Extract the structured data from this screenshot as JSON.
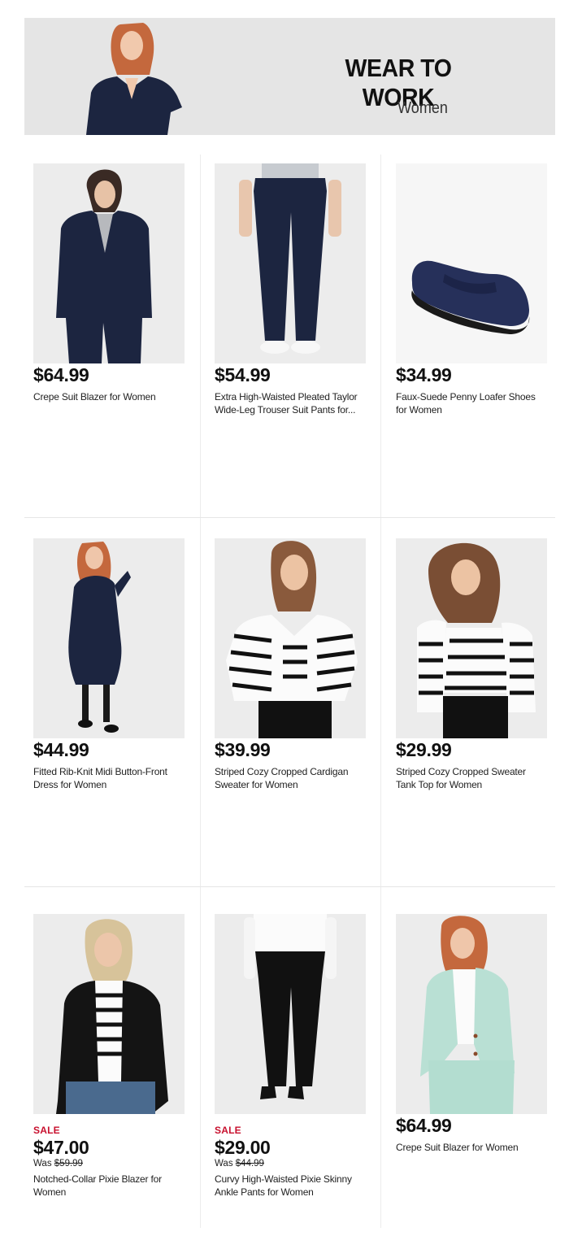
{
  "banner": {
    "title": "WEAR TO WORK",
    "subtitle": "Women"
  },
  "products": [
    {
      "price": "$64.99",
      "name": "Crepe Suit Blazer for Women",
      "sale_label": "",
      "was_prefix": "",
      "was_price": ""
    },
    {
      "price": "$54.99",
      "name": "Extra High-Waisted Pleated Taylor Wide-Leg Trouser Suit Pants for...",
      "sale_label": "",
      "was_prefix": "",
      "was_price": ""
    },
    {
      "price": "$34.99",
      "name": "Faux-Suede Penny Loafer Shoes for Women",
      "sale_label": "",
      "was_prefix": "",
      "was_price": ""
    },
    {
      "price": "$44.99",
      "name": "Fitted Rib-Knit Midi Button-Front Dress for Women",
      "sale_label": "",
      "was_prefix": "",
      "was_price": ""
    },
    {
      "price": "$39.99",
      "name": "Striped Cozy Cropped Cardigan Sweater for Women",
      "sale_label": "",
      "was_prefix": "",
      "was_price": ""
    },
    {
      "price": "$29.99",
      "name": "Striped Cozy Cropped Sweater Tank Top for Women",
      "sale_label": "",
      "was_prefix": "",
      "was_price": ""
    },
    {
      "price": "$47.00",
      "name": "Notched-Collar Pixie Blazer for Women",
      "sale_label": "SALE",
      "was_prefix": "Was ",
      "was_price": "$59.99"
    },
    {
      "price": "$29.00",
      "name": "Curvy High-Waisted Pixie Skinny Ankle Pants for Women",
      "sale_label": "SALE",
      "was_prefix": "Was ",
      "was_price": "$44.99"
    },
    {
      "price": "$64.99",
      "name": "Crepe Suit Blazer for Women",
      "sale_label": "",
      "was_prefix": "",
      "was_price": ""
    }
  ],
  "colors": {
    "sale_red": "#c8102e",
    "navy": "#1c2540",
    "banner_bg": "#e5e5e5"
  }
}
